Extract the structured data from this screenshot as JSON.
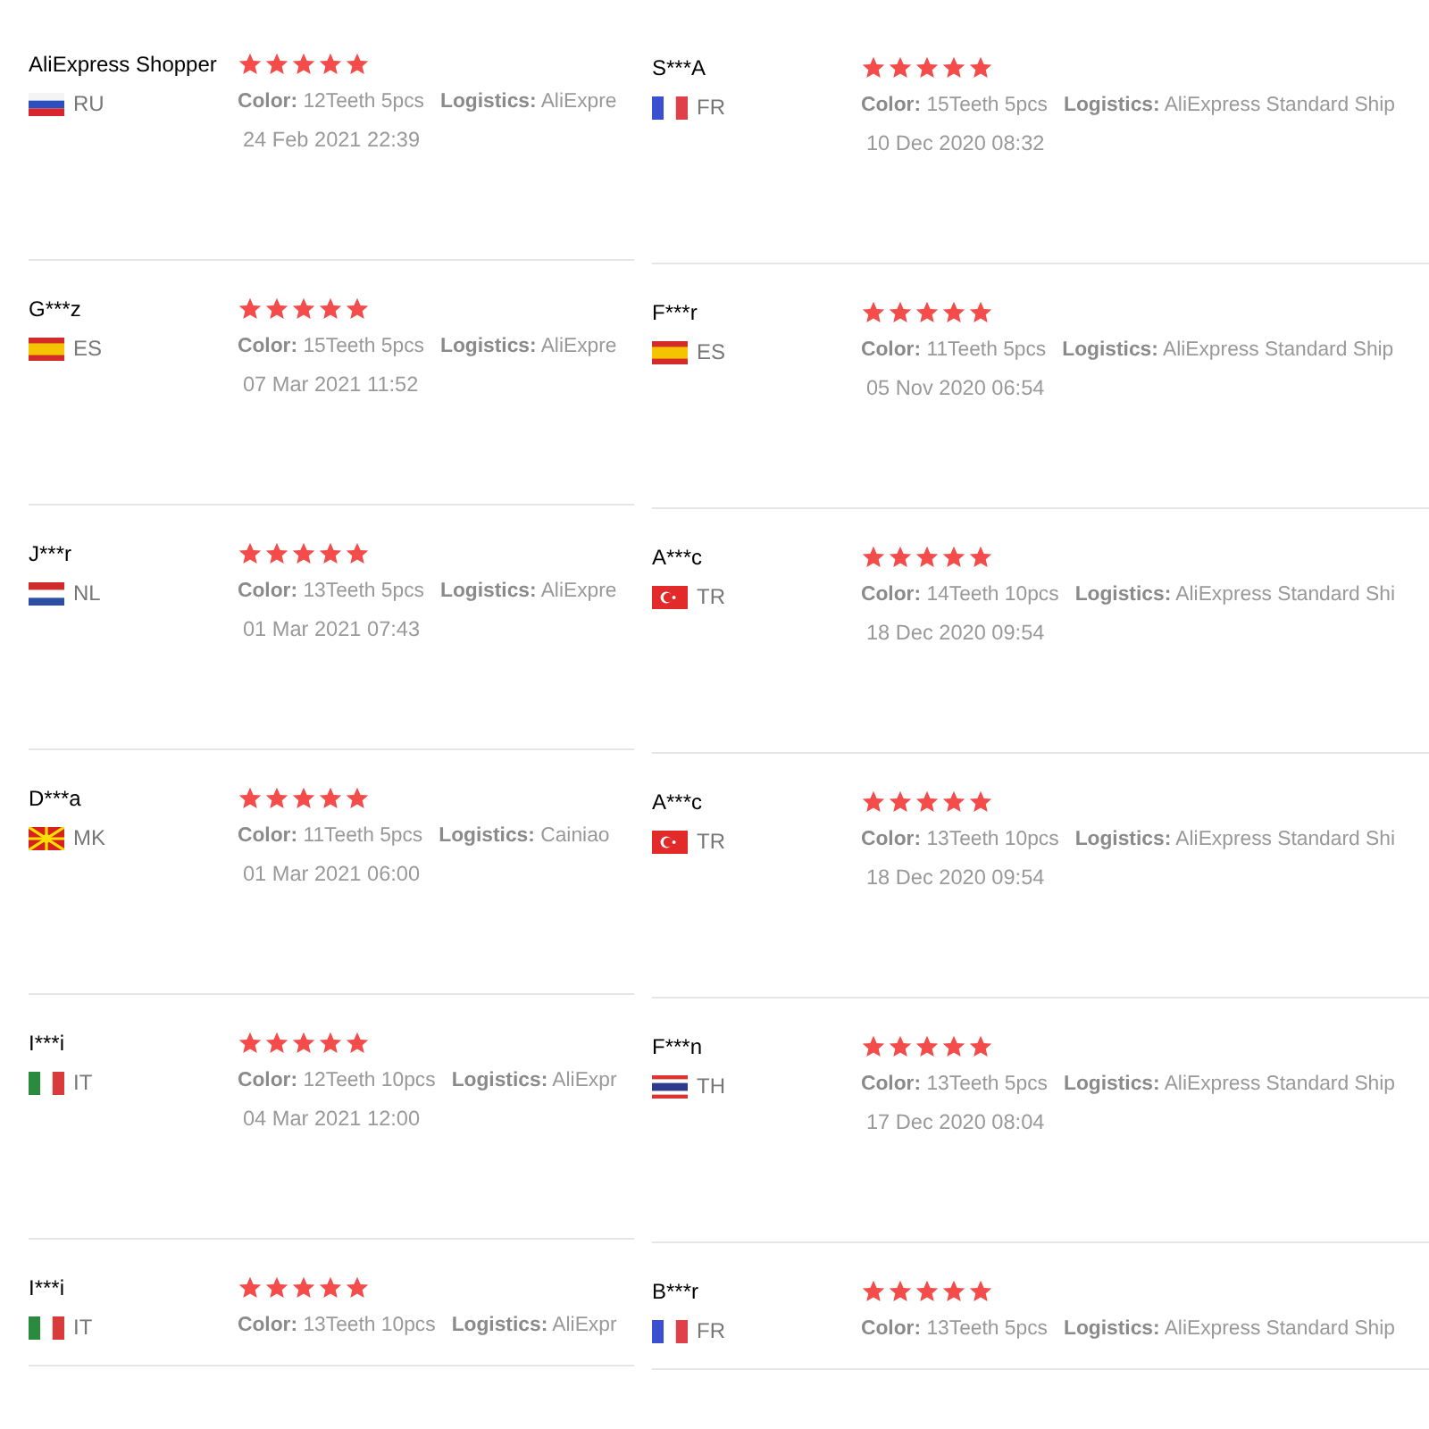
{
  "columns": [
    {
      "reviews": [
        {
          "name": "AliExpress Shopper",
          "flag": {
            "kind": "ru"
          },
          "country": "RU",
          "stars": 5,
          "color_label": "Color:",
          "color_value": "12Teeth 5pcs",
          "logistics_label": "Logistics:",
          "logistics_value": "AliExpre",
          "date": "24 Feb 2021 22:39"
        },
        {
          "name": "G***z",
          "flag": {
            "kind": "es"
          },
          "country": "ES",
          "stars": 5,
          "color_label": "Color:",
          "color_value": "15Teeth 5pcs",
          "logistics_label": "Logistics:",
          "logistics_value": "AliExpre",
          "date": "07 Mar 2021 11:52"
        },
        {
          "name": "J***r",
          "flag": {
            "kind": "nl"
          },
          "country": "NL",
          "stars": 5,
          "color_label": "Color:",
          "color_value": "13Teeth 5pcs",
          "logistics_label": "Logistics:",
          "logistics_value": "AliExpre",
          "date": "01 Mar 2021 07:43"
        },
        {
          "name": "D***a",
          "flag": {
            "kind": "mk"
          },
          "country": "MK",
          "stars": 5,
          "color_label": "Color:",
          "color_value": "11Teeth 5pcs",
          "logistics_label": "Logistics:",
          "logistics_value": "Cainiao",
          "date": "01 Mar 2021 06:00"
        },
        {
          "name": "I***i",
          "flag": {
            "kind": "it"
          },
          "country": "IT",
          "stars": 5,
          "color_label": "Color:",
          "color_value": "12Teeth 10pcs",
          "logistics_label": "Logistics:",
          "logistics_value": "AliExpr",
          "date": "04 Mar 2021 12:00"
        },
        {
          "name": "I***i",
          "flag": {
            "kind": "it"
          },
          "country": "IT",
          "stars": 5,
          "color_label": "Color:",
          "color_value": "13Teeth 10pcs",
          "logistics_label": "Logistics:",
          "logistics_value": "AliExpr"
        }
      ]
    },
    {
      "reviews": [
        {
          "name": "S***A",
          "flag": {
            "kind": "fr"
          },
          "country": "FR",
          "stars": 5,
          "color_label": "Color:",
          "color_value": "15Teeth 5pcs",
          "logistics_label": "Logistics:",
          "logistics_value": "AliExpress Standard Ship",
          "date": "10 Dec 2020 08:32"
        },
        {
          "name": "F***r",
          "flag": {
            "kind": "es"
          },
          "country": "ES",
          "stars": 5,
          "color_label": "Color:",
          "color_value": "11Teeth 5pcs",
          "logistics_label": "Logistics:",
          "logistics_value": "AliExpress Standard Ship",
          "date": "05 Nov 2020 06:54"
        },
        {
          "name": "A***c",
          "flag": {
            "kind": "tr"
          },
          "country": "TR",
          "stars": 5,
          "color_label": "Color:",
          "color_value": "14Teeth 10pcs",
          "logistics_label": "Logistics:",
          "logistics_value": "AliExpress Standard Shi",
          "date": "18 Dec 2020 09:54"
        },
        {
          "name": "A***c",
          "flag": {
            "kind": "tr"
          },
          "country": "TR",
          "stars": 5,
          "color_label": "Color:",
          "color_value": "13Teeth 10pcs",
          "logistics_label": "Logistics:",
          "logistics_value": "AliExpress Standard Shi",
          "date": "18 Dec 2020 09:54"
        },
        {
          "name": "F***n",
          "flag": {
            "kind": "th"
          },
          "country": "TH",
          "stars": 5,
          "color_label": "Color:",
          "color_value": "13Teeth 5pcs",
          "logistics_label": "Logistics:",
          "logistics_value": "AliExpress Standard Ship",
          "date": "17 Dec 2020 08:04"
        },
        {
          "name": "B***r",
          "flag": {
            "kind": "fr"
          },
          "country": "FR",
          "stars": 5,
          "color_label": "Color:",
          "color_value": "13Teeth 5pcs",
          "logistics_label": "Logistics:",
          "logistics_value": "AliExpress Standard Ship"
        }
      ]
    }
  ]
}
